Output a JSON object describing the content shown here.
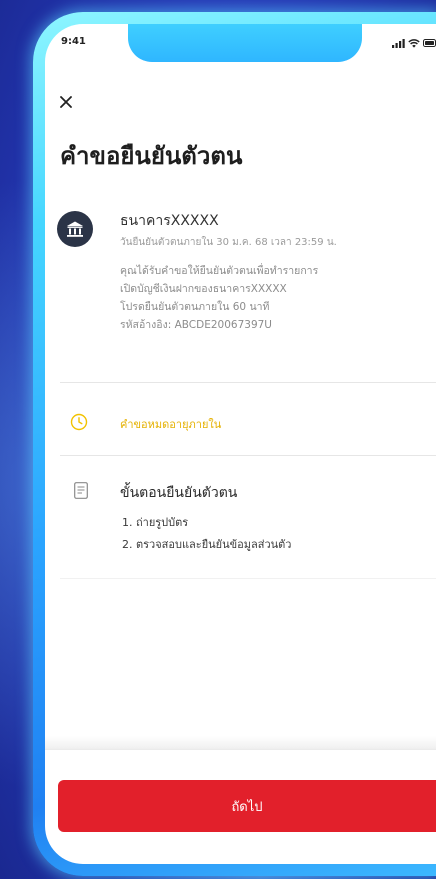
{
  "status_bar": {
    "time": "9:41",
    "icons": [
      "signal-icon",
      "wifi-icon",
      "battery-icon"
    ]
  },
  "header": {
    "close_icon": "close-icon"
  },
  "title": "คำขอยืนยันตัวตน",
  "request": {
    "bank_icon": "bank-icon",
    "bank_name": "ธนาคารXXXXX",
    "deadline": "วันยืนยันตัวตนภายใน 30 ม.ค. 68 เวลา 23:59 น.",
    "description": [
      "คุณได้รับคำขอให้ยืนยันตัวตนเพื่อทำรายการ",
      "เปิดบัญชีเงินฝากของธนาคารXXXXX",
      "โปรดยืนยันตัวตนภายใน 60 นาที",
      "รหัสอ้างอิง: ABCDE20067397U"
    ]
  },
  "notice": {
    "icon": "clock-icon",
    "text": "คำขอหมดอายุภายใน"
  },
  "steps": {
    "icon": "document-icon",
    "heading": "ขั้นตอนยืนยันตัวตน",
    "items": [
      "1. ถ่ายรูปบัตร",
      "2. ตรวจสอบและยืนยันข้อมูลส่วนตัว"
    ]
  },
  "footer": {
    "next_label": "ถัดไป"
  },
  "colors": {
    "accent_red": "#e2202b",
    "notice_yellow": "#e5b100",
    "bank_icon_bg": "#2b3447",
    "background_blue": "#2e46c8",
    "frame_cyan": "#45d6ff"
  }
}
